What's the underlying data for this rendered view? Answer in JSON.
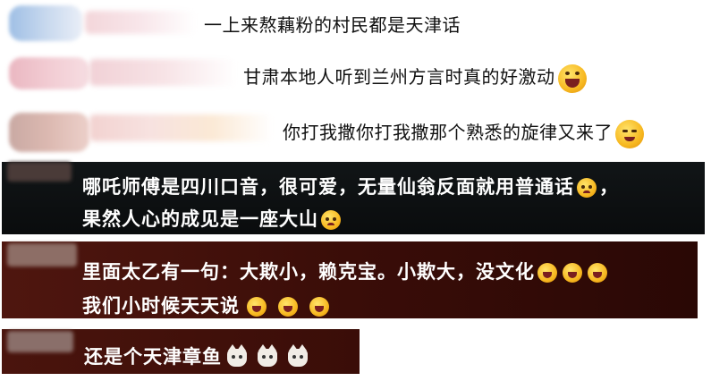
{
  "comments": [
    {
      "text": "一上来熬藕粉的村民都是天津话",
      "emojis": []
    },
    {
      "text": "甘肃本地人听到兰州方言时真的好激动",
      "emojis": [
        "laugh-emoji"
      ]
    },
    {
      "text": "你打我撒你打我撒那个熟悉的旋律又来了",
      "emojis": [
        "smile-emoji"
      ]
    },
    {
      "line1": "哪吒师傅是四川口音，很可爱，无量仙翁反面就用普通话",
      "line1_tail": "，",
      "line2": "果然人心的成见是一座大山",
      "emojis": [
        "sad-emoji",
        "sad-emoji"
      ]
    },
    {
      "line1": "里面太乙有一句：大欺小，赖克宝。小欺大，没文化",
      "line2": "我们小时候天天说",
      "emojis": [
        "laugh-cry-emoji",
        "laugh-cry-emoji",
        "laugh-cry-emoji",
        "laugh-cry-emoji",
        "laugh-cry-emoji",
        "laugh-cry-emoji"
      ]
    },
    {
      "text": "还是个天津章鱼",
      "emojis": [
        "cat-emoji",
        "cat-emoji",
        "cat-emoji"
      ]
    }
  ]
}
